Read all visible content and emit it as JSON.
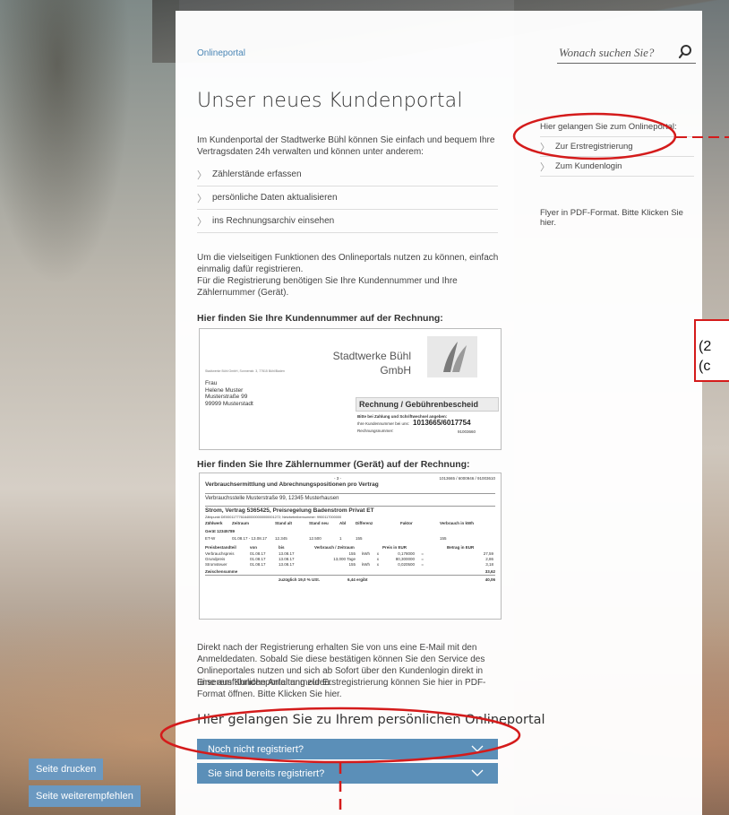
{
  "breadcrumb": "Onlineportal",
  "search": {
    "placeholder": "Wonach suchen Sie?",
    "icon": "search-icon"
  },
  "title": "Unser neues Kundenportal",
  "intro": "Im Kundenportal der Stadtwerke Bühl können Sie einfach und bequem Ihre Vertragsdaten 24h verwalten und können unter anderem:",
  "features": [
    "Zählerstände erfassen",
    "persönliche Daten aktualisieren",
    "ins Rechnungsarchiv einsehen"
  ],
  "para1": "Um die vielseitigen Funktionen des Onlineportals nutzen zu können, einfach einmalig dafür registrieren.",
  "para2": "Für die Registrierung benötigen Sie Ihre Kundennummer und Ihre Zählernummer (Gerät).",
  "heading_customer_no": "Hier finden Sie Ihre Kundennummer auf der Rechnung:",
  "heading_meter_no": "Hier finden Sie Ihre Zählernummer (Gerät) auf der Rechnung:",
  "invoice1": {
    "company": "Stadtwerke Bühl",
    "company2": "GmbH",
    "sender": "Stadtwerke Bühl GmbH, Sonnenstr. 3, 77815 Bühl/Baden",
    "recipient": [
      "Frau",
      "Helene Muster",
      "Musterstraße 99",
      "99999 Musterstadt"
    ],
    "doc_title": "Rechnung / Gebührenbescheid",
    "note": "Bitte bei Zahlung und Schriftwechsel angeben:",
    "customer_label": "Ihre Kundennummer bei uns:",
    "customer_no": "1013665/6017754",
    "invoice_label": "Rechnungsnummer:",
    "invoice_no": "91003660"
  },
  "invoice2": {
    "page": "- 3 -",
    "ref": "1013665 / 6000946 / 91003610",
    "heading": "Verbrauchsermittlung und Abrechnungspositionen pro Vertrag",
    "location": "Verbrauchsstelle   Musterstraße 99, 12345 Musterhausen",
    "contract": "Strom, Vertrag 5365425, Preisregelung Badenstrom Privat ET",
    "meterpoint": "Zählpunkt DE00011777616400000000000001272; Netzbetreibernummer: 9900117000000",
    "cols": [
      "Zählwerk",
      "Zeitraum",
      "Stand alt",
      "Stand neu",
      "Abl",
      "Differenz",
      "Faktor",
      "Verbrauch in kWh"
    ],
    "device": "Gerät 12345789",
    "row1": [
      "ET-W",
      "01.08.17 - 13.08.17",
      "12.345",
      "12.500",
      "1",
      "155",
      "",
      "155"
    ],
    "price_head": [
      "Preisbestandteil",
      "von",
      "bis",
      "Verbrauch / Zeitraum",
      "Preis in EUR",
      "Betrag in EUR"
    ],
    "price_rows": [
      [
        "Verbrauchspreis",
        "01.08.17",
        "13.08.17",
        "155",
        "kWh",
        "x",
        "0,178000",
        "=",
        "27,59"
      ],
      [
        "Grundpreis",
        "01.08.17",
        "13.08.17",
        "13,000 Tage",
        "",
        "x",
        "80,300000",
        "=",
        "2,86"
      ],
      [
        "Stromsteuer",
        "01.08.17",
        "13.08.17",
        "155",
        "kWh",
        "x",
        "0,020500",
        "=",
        "3,18"
      ]
    ],
    "subtotal_label": "Zwischensumme",
    "subtotal": "33,62",
    "vat": "zuzüglich  19,0 % USt.",
    "vat_amount": "6,44 ergibt",
    "total": "40,06"
  },
  "para3": "Direkt nach der Registrierung erhalten Sie von uns eine E-Mail mit den Anmeldedaten. Sobald Sie diese bestätigen können Sie den Service des Onlineportales nutzen und sich ab Sofort über den Kundenlogin direkt in unserem Kundenportal anmelden.",
  "para4": "Eine ausführliche Anleitung zur Erstregistrierung können Sie hier in PDF-Format öffnen. Bitte Klicken Sie hier.",
  "portal_heading": "Hier gelangen Sie zu Ihrem persönlichen Onlineportal",
  "accordion": [
    "Noch nicht registriert?",
    "Sie sind bereits registriert?"
  ],
  "right": {
    "intro": "Hier gelangen Sie zum Onlineportal:",
    "links": [
      "Zur Erstregistrierung",
      "Zum Kundenlogin"
    ],
    "flyer": "Flyer in PDF-Format. Bitte Klicken Sie hier."
  },
  "side_buttons": [
    "Seite drucken",
    "Seite weiterempfehlen"
  ],
  "annotation": [
    "(2",
    "(c"
  ],
  "colors": {
    "accent": "#5b8fb8",
    "annotation": "#d41b1b",
    "link": "#4a86b5"
  }
}
